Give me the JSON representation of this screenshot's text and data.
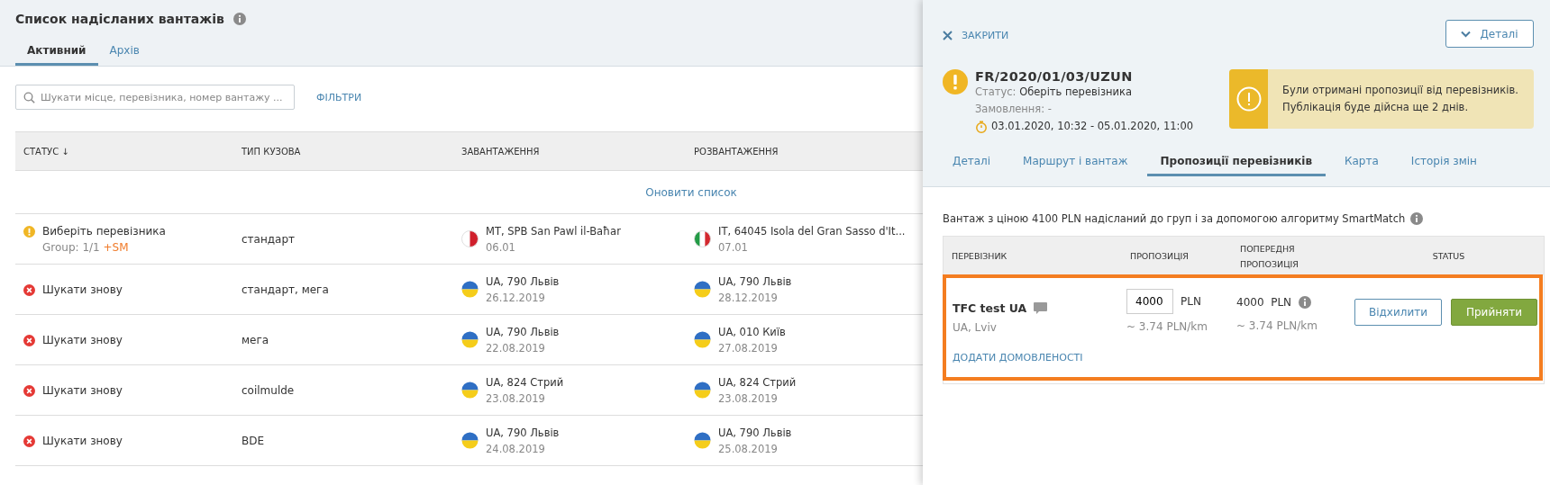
{
  "page": {
    "title": "Список надісланих вантажів",
    "tabs": [
      {
        "label": "Активний",
        "selected": true
      },
      {
        "label": "Архів",
        "selected": false
      }
    ],
    "search": {
      "placeholder": "Шукати місце, перевізника, номер вантажу ..."
    },
    "filters": "ФІЛЬТРИ"
  },
  "table": {
    "columns": [
      "СТАТУС",
      "ТИП КУЗОВА",
      "ЗАВАНТАЖЕННЯ",
      "РОЗВАНТАЖЕННЯ"
    ],
    "sort_mark": "↓",
    "refresh": "Оновити список",
    "rows": [
      {
        "kind": "warning",
        "status": "Виберіть перевізника",
        "group": "Group: 1/1",
        "sm": "+SM",
        "body": "стандарт",
        "loading": {
          "kind": "mt",
          "place": "MT, SPB San Pawl il-Baħar",
          "date": "06.01"
        },
        "unloading": {
          "kind": "it",
          "place": "IT, 64045 Isola del Gran Sasso d'It...",
          "date": "07.01"
        }
      },
      {
        "kind": "error",
        "status": "Шукати знову",
        "body": "стандарт, мега",
        "loading": {
          "kind": "ua",
          "place": "UA, 790 Львів",
          "date": "26.12.2019"
        },
        "unloading": {
          "kind": "ua",
          "place": "UA, 790 Львів",
          "date": "28.12.2019"
        }
      },
      {
        "kind": "error",
        "status": "Шукати знову",
        "body": "мега",
        "loading": {
          "kind": "ua",
          "place": "UA, 790 Львів",
          "date": "22.08.2019"
        },
        "unloading": {
          "kind": "ua",
          "place": "UA, 010 Київ",
          "date": "27.08.2019"
        }
      },
      {
        "kind": "error",
        "status": "Шукати знову",
        "body": "coilmulde",
        "loading": {
          "kind": "ua",
          "place": "UA, 824 Стрий",
          "date": "23.08.2019"
        },
        "unloading": {
          "kind": "ua",
          "place": "UA, 824 Стрий",
          "date": "23.08.2019"
        }
      },
      {
        "kind": "error",
        "status": "Шукати знову",
        "body": "BDE",
        "loading": {
          "kind": "ua",
          "place": "UA, 790 Львів",
          "date": "24.08.2019"
        },
        "unloading": {
          "kind": "ua",
          "place": "UA, 790 Львів",
          "date": "25.08.2019"
        }
      }
    ]
  },
  "panel": {
    "close": "ЗАКРИТИ",
    "details_button": "Деталі",
    "cargo_id": "FR/2020/01/03/UZUN",
    "status_label": "Статус:",
    "status_value": "Оберіть перевізника",
    "order_label": "Замовлення:",
    "order_value": "-",
    "period": "03.01.2020, 10:32 - 05.01.2020, 11:00",
    "alert": "Були отримані пропозиції від перевізників. Публікація буде дійсна ще 2 днів.",
    "tabs": [
      {
        "label": "Деталі",
        "selected": false
      },
      {
        "label": "Маршрут і вантаж",
        "selected": false
      },
      {
        "label": "Пропозиції перевізників",
        "selected": true
      },
      {
        "label": "Карта",
        "selected": false
      },
      {
        "label": "Історія змін",
        "selected": false
      }
    ],
    "info": "Вантаж з ціною 4100 PLN надісланий до груп і за допомогою алгоритму SmartMatch",
    "offers": {
      "columns": [
        "ПЕРЕВІЗНИК",
        "ПРОПОЗИЦІЯ",
        "ПОПЕРЕДНЯ ПРОПОЗИЦІЯ",
        "STATUS"
      ],
      "rows": [
        {
          "carrier": "TFC test UA",
          "location": "UA, Lviv",
          "offer": "4000",
          "currency": "PLN",
          "offer_rate": "~ 3.74 PLN/km",
          "previous": "4000  PLN",
          "previous_rate": "~ 3.74 PLN/km",
          "reject": "Відхилити",
          "accept": "Прийняти",
          "add_terms": "ДОДАТИ ДОМОВЛЕНОСТІ",
          "highlighted": true
        }
      ]
    }
  }
}
